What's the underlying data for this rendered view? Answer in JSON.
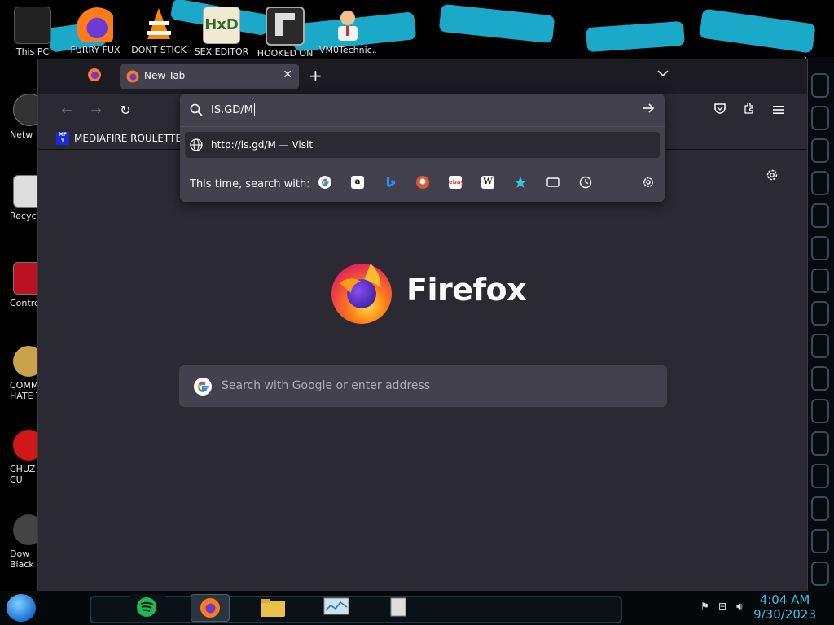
{
  "desktop": {
    "top_icons": [
      {
        "label": "This PC"
      },
      {
        "label": "FURRY FUX"
      },
      {
        "label": "DONT STICK"
      },
      {
        "label": "SEX EDITOR"
      },
      {
        "label": "HOOKED ON"
      },
      {
        "label": "VM0Technic..."
      }
    ],
    "left_icons": [
      {
        "label": "Netw"
      },
      {
        "label": "Recycl"
      },
      {
        "label": "Control"
      },
      {
        "label": "COMMU",
        "label2": "HATE TH"
      },
      {
        "label": "CHUZ",
        "label2": "CU"
      },
      {
        "label": "Dow",
        "label2": "Black"
      }
    ]
  },
  "browser": {
    "tab": {
      "title": "New Tab",
      "close_glyph": "✕"
    },
    "new_tab_glyph": "+",
    "tab_list_glyph": "⌄",
    "nav": {
      "back": "←",
      "forward": "→",
      "reload": "↻"
    },
    "toolbar_icons": [
      "pocket-icon",
      "extensions-icon",
      "menu-icon"
    ],
    "bookmark": {
      "icon_text": "MF T",
      "label": "MEDIAFIRE ROULETTER"
    },
    "url_popup": {
      "typed": "IS.GD/M",
      "result_url": "http://is.gd/M",
      "result_sep": "—",
      "result_action": "Visit",
      "search_with": "This time, search with:",
      "engines": [
        "google-icon",
        "amazon-icon",
        "bing-icon",
        "duckduckgo-icon",
        "ebay-icon",
        "wikipedia-icon",
        "bookmarks-icon",
        "tabs-icon",
        "history-icon"
      ]
    },
    "newtab": {
      "brand": "Firefox",
      "search_placeholder": "Search with Google or enter address"
    }
  },
  "taskbar": {
    "time": "4:04 AM",
    "date": "9/30/2023"
  },
  "colors": {
    "accent": "#1aa9c9",
    "bg": "#2b2a33",
    "panel": "#42414d",
    "text": "#fbfbfe"
  }
}
